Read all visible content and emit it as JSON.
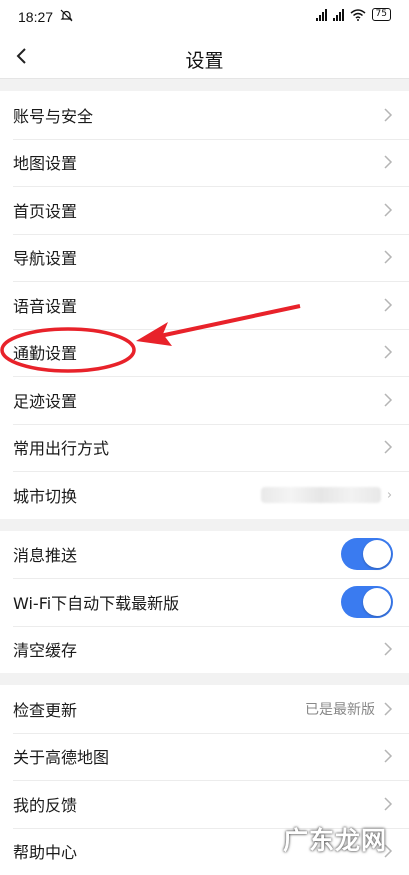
{
  "statusbar": {
    "time": "18:27",
    "battery": "75"
  },
  "header": {
    "title": "设置"
  },
  "groups": {
    "a": [
      {
        "label": "账号与安全"
      },
      {
        "label": "地图设置"
      },
      {
        "label": "首页设置"
      },
      {
        "label": "导航设置"
      },
      {
        "label": "语音设置"
      },
      {
        "label": "通勤设置"
      },
      {
        "label": "足迹设置"
      },
      {
        "label": "常用出行方式"
      },
      {
        "label": "城市切换"
      }
    ],
    "b": [
      {
        "label": "消息推送",
        "toggle": "on"
      },
      {
        "label": "Wi-Fi下自动下载最新版",
        "toggle": "on"
      },
      {
        "label": "清空缓存"
      }
    ],
    "c": [
      {
        "label": "检查更新",
        "value": "已是最新版"
      },
      {
        "label": "关于高德地图"
      },
      {
        "label": "我的反馈"
      },
      {
        "label": "帮助中心"
      }
    ]
  },
  "colors": {
    "toggle": "#3a7bf0",
    "annotation": "#e8222a"
  },
  "icons": {
    "back": "chevron-left-icon",
    "row": "chevron-right-icon"
  },
  "watermark": "广东龙网"
}
